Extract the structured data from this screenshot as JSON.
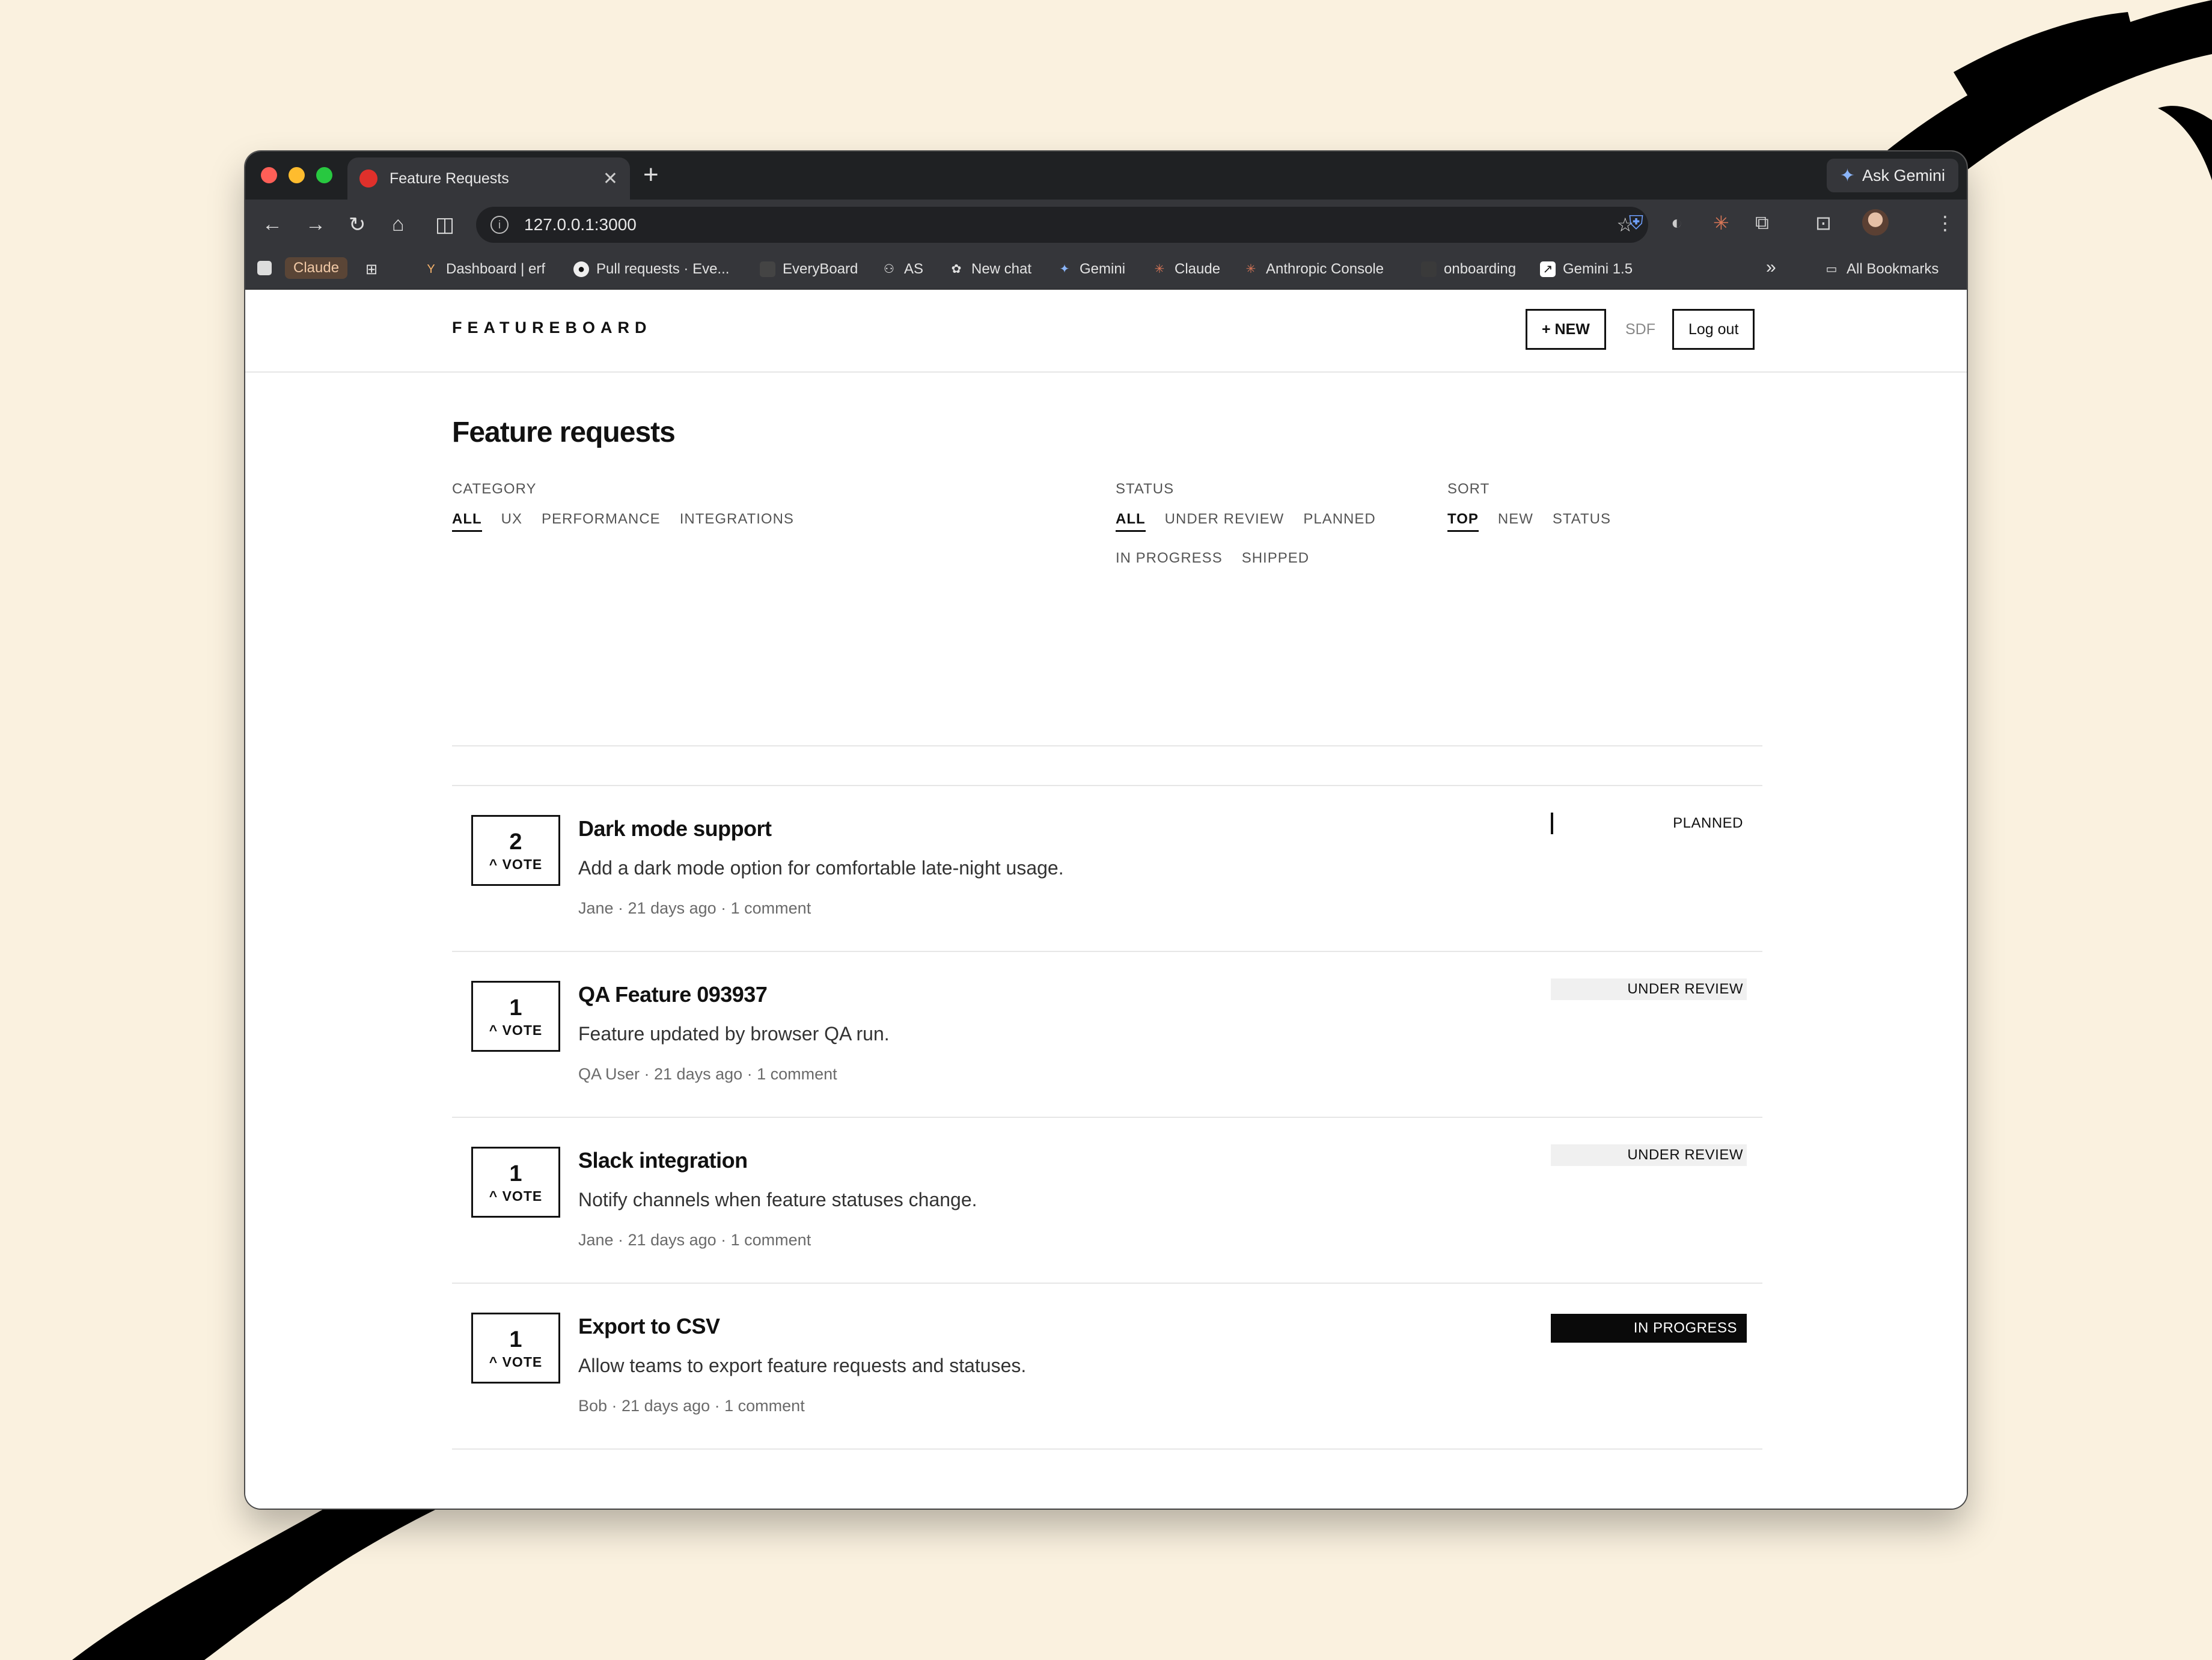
{
  "browser": {
    "tab_title": "Feature Requests",
    "new_tab": "+",
    "ask_gemini": "Ask Gemini",
    "url": "127.0.0.1:3000",
    "bookmarks": [
      {
        "label": "Claude",
        "icon": "claude-pill"
      },
      {
        "label": "Dashboard | erf",
        "icon": "y-icon"
      },
      {
        "label": "Pull requests · Eve...",
        "icon": "github-icon"
      },
      {
        "label": "EveryBoard",
        "icon": "everyboard-icon"
      },
      {
        "label": "AS",
        "icon": "people-icon"
      },
      {
        "label": "New chat",
        "icon": "openai-icon"
      },
      {
        "label": "Gemini",
        "icon": "gemini-icon"
      },
      {
        "label": "Claude",
        "icon": "claude-icon"
      },
      {
        "label": "Anthropic Console",
        "icon": "anthropic-icon"
      },
      {
        "label": "onboarding",
        "icon": "folder-icon"
      },
      {
        "label": "Gemini 1.5",
        "icon": "external-icon"
      }
    ],
    "overflow": "»",
    "all_bookmarks": "All Bookmarks"
  },
  "app": {
    "brand": "FEATUREBOARD",
    "new_button": "+ NEW",
    "user": "SDF",
    "logout_button": "Log out",
    "page_title": "Feature requests",
    "filters": {
      "category": {
        "label": "CATEGORY",
        "options": [
          "ALL",
          "UX",
          "PERFORMANCE",
          "INTEGRATIONS"
        ],
        "active": "ALL"
      },
      "status": {
        "label": "STATUS",
        "options": [
          "ALL",
          "UNDER REVIEW",
          "PLANNED",
          "IN PROGRESS",
          "SHIPPED"
        ],
        "active": "ALL"
      },
      "sort": {
        "label": "SORT",
        "options": [
          "TOP",
          "NEW",
          "STATUS"
        ],
        "active": "TOP"
      }
    },
    "requests": [
      {
        "votes": "2",
        "vote_label": "^ VOTE",
        "title": "Dark mode support",
        "description": "Add a dark mode option for comfortable late-night usage.",
        "meta": "Jane · 21 days ago · 1 comment",
        "status": "PLANNED"
      },
      {
        "votes": "1",
        "vote_label": "^ VOTE",
        "title": "QA Feature 093937",
        "description": "Feature updated by browser QA run.",
        "meta": "QA User · 21 days ago · 1 comment",
        "status": "UNDER REVIEW"
      },
      {
        "votes": "1",
        "vote_label": "^ VOTE",
        "title": "Slack integration",
        "description": "Notify channels when feature statuses change.",
        "meta": "Jane · 21 days ago · 1 comment",
        "status": "UNDER REVIEW"
      },
      {
        "votes": "1",
        "vote_label": "^ VOTE",
        "title": "Export to CSV",
        "description": "Allow teams to export feature requests and statuses.",
        "meta": "Bob · 21 days ago · 1 comment",
        "status": "IN PROGRESS"
      }
    ]
  }
}
